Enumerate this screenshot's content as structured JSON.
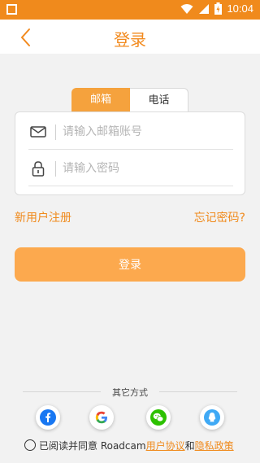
{
  "statusbar": {
    "time": "10:04"
  },
  "navbar": {
    "title": "登录"
  },
  "tabs": {
    "email": "邮箱",
    "phone": "电话"
  },
  "form": {
    "email_placeholder": "请输入邮箱账号",
    "email_value": "",
    "password_placeholder": "请输入密码",
    "password_value": ""
  },
  "links": {
    "register": "新用户注册",
    "forgot": "忘记密码?"
  },
  "login_button": "登录",
  "other_methods": {
    "label": "其它方式",
    "providers": [
      "facebook-icon",
      "google-icon",
      "wechat-icon",
      "qq-icon"
    ]
  },
  "agreement": {
    "prefix": "已阅读并同意 Roadcam",
    "user_agreement": "用户协议",
    "and": "和",
    "privacy_policy": "隐私政策"
  },
  "colors": {
    "accent": "#f08a1c",
    "button": "#fca94e",
    "tab_active": "#f5a23d"
  }
}
